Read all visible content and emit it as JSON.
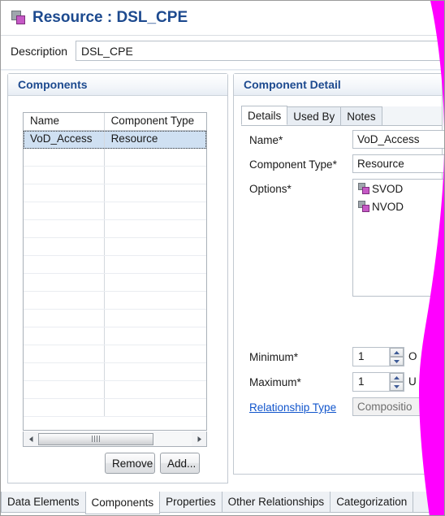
{
  "window": {
    "title": "Resource : DSL_CPE",
    "title_icon": "component-icon"
  },
  "description": {
    "label": "Description",
    "value": "DSL_CPE",
    "placeholder": ""
  },
  "components_panel": {
    "title": "Components",
    "columns": [
      "Name",
      "Component Type"
    ],
    "rows": [
      {
        "name": "VoD_Access",
        "type": "Resource",
        "selected": true
      }
    ],
    "empty_row_count": 15,
    "scrollbar": {
      "left_arrow": "scroll-left-icon",
      "right_arrow": "scroll-right-icon",
      "grip": "scrollbar-grip"
    },
    "buttons": {
      "remove": "Remove",
      "add": "Add..."
    }
  },
  "detail_panel": {
    "title": "Component Detail",
    "tabs": [
      {
        "label": "Details",
        "active": true
      },
      {
        "label": "Used By",
        "active": false
      },
      {
        "label": "Notes",
        "active": false
      }
    ],
    "fields": {
      "name_label": "Name*",
      "name_value": "VoD_Access",
      "component_type_label": "Component Type*",
      "component_type_value": "Resource",
      "options_label": "Options*",
      "options": [
        {
          "label": "SVOD",
          "icon": "component-icon"
        },
        {
          "label": "NVOD",
          "icon": "component-icon"
        }
      ],
      "minimum_label": "Minimum*",
      "minimum_value": "1",
      "minimum_suffix": "O",
      "maximum_label": "Maximum*",
      "maximum_value": "1",
      "maximum_suffix": "U",
      "relationship_type_link": "Relationship Type",
      "relationship_type_value": "Compositio"
    }
  },
  "bottom_tabs": [
    {
      "label": "Data Elements",
      "active": false
    },
    {
      "label": "Components",
      "active": true
    },
    {
      "label": "Properties",
      "active": false
    },
    {
      "label": "Other Relationships",
      "active": false
    },
    {
      "label": "Categorization",
      "active": false
    }
  ],
  "colors": {
    "title_blue": "#1d4a8f",
    "link_blue": "#1155cc",
    "selection_blue": "#cfe0f2",
    "overlay_magenta": "#ff00ff"
  }
}
